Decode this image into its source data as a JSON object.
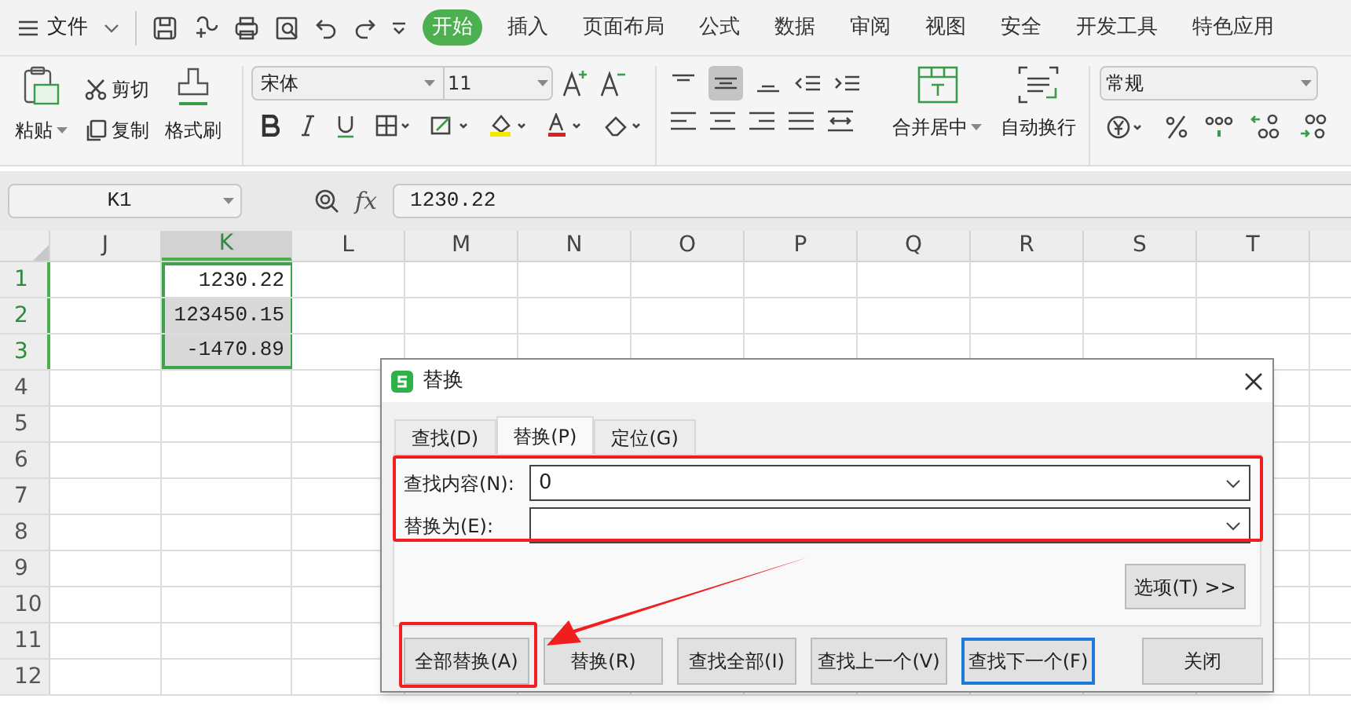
{
  "menu": {
    "file": "文件",
    "tabs": [
      {
        "label": "开始",
        "selected": true
      },
      {
        "label": "插入",
        "selected": false
      },
      {
        "label": "页面布局",
        "selected": false
      },
      {
        "label": "公式",
        "selected": false
      },
      {
        "label": "数据",
        "selected": false
      },
      {
        "label": "审阅",
        "selected": false
      },
      {
        "label": "视图",
        "selected": false
      },
      {
        "label": "安全",
        "selected": false
      },
      {
        "label": "开发工具",
        "selected": false
      },
      {
        "label": "特色应用",
        "selected": false
      }
    ]
  },
  "ribbon": {
    "paste": "粘贴",
    "cut": "剪切",
    "copy": "复制",
    "format_painter": "格式刷",
    "font_name": "宋体",
    "font_size": "11",
    "merge": "合并居中",
    "wrap": "自动换行",
    "number_format": "常规"
  },
  "formula_bar": {
    "cell": "K1",
    "function_label": "fx",
    "value": "1230.22"
  },
  "sheet": {
    "columns": [
      {
        "label": "J",
        "selected": false
      },
      {
        "label": "K",
        "selected": true
      },
      {
        "label": "L",
        "selected": false
      },
      {
        "label": "M",
        "selected": false
      },
      {
        "label": "N",
        "selected": false
      },
      {
        "label": "O",
        "selected": false
      },
      {
        "label": "P",
        "selected": false
      },
      {
        "label": "Q",
        "selected": false
      },
      {
        "label": "R",
        "selected": false
      },
      {
        "label": "S",
        "selected": false
      },
      {
        "label": "T",
        "selected": false
      }
    ],
    "rows": [
      {
        "label": "1",
        "selected": true,
        "value": {
          "text": "1230.22",
          "active": true
        }
      },
      {
        "label": "2",
        "selected": true,
        "value": {
          "text": "123450.15",
          "active": false
        }
      },
      {
        "label": "3",
        "selected": true,
        "value": {
          "text": "-1470.89",
          "active": false
        }
      },
      {
        "label": "4",
        "selected": false
      },
      {
        "label": "5",
        "selected": false
      },
      {
        "label": "6",
        "selected": false
      },
      {
        "label": "7",
        "selected": false
      },
      {
        "label": "8",
        "selected": false
      },
      {
        "label": "9",
        "selected": false
      },
      {
        "label": "10",
        "selected": false
      },
      {
        "label": "11",
        "selected": false
      },
      {
        "label": "12",
        "selected": false
      }
    ]
  },
  "dialog": {
    "title": "替换",
    "tabs": [
      {
        "label": "查找(D)",
        "selected": false
      },
      {
        "label": "替换(P)",
        "selected": true
      },
      {
        "label": "定位(G)",
        "selected": false
      }
    ],
    "fields": [
      {
        "label": "查找内容(N):",
        "value": "0"
      },
      {
        "label": "替换为(E):"
      }
    ],
    "options": "选项(T) >>",
    "buttons": [
      {
        "label": "全部替换(A)",
        "focused": false
      },
      {
        "label": "替换(R)",
        "focused": false
      },
      {
        "label": "查找全部(I)",
        "focused": false
      },
      {
        "label": "查找上一个(V)",
        "focused": false
      },
      {
        "label": "查找下一个(F)",
        "focused": true
      }
    ],
    "close": "关闭"
  }
}
